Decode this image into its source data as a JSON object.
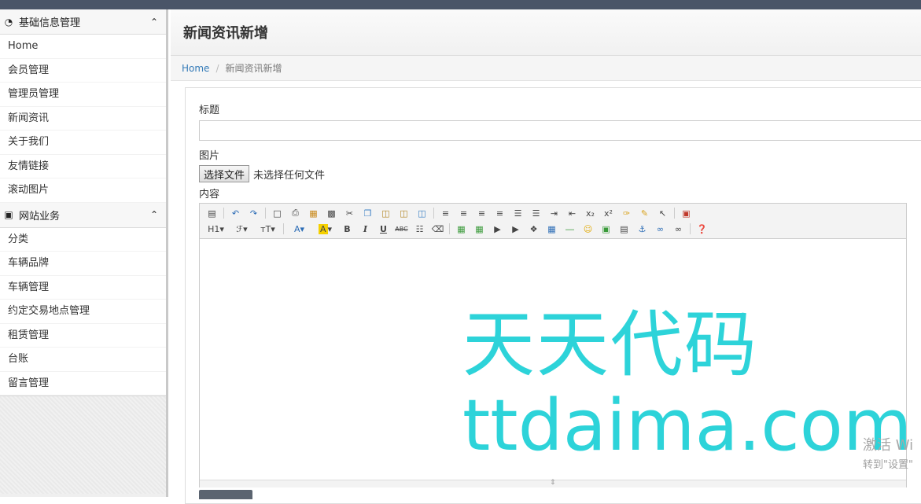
{
  "sidebar": {
    "sections": [
      {
        "title": "基础信息管理",
        "icon": "dashboard-icon",
        "items": [
          "Home",
          "会员管理",
          "管理员管理",
          "新闻资讯",
          "关于我们",
          "友情链接",
          "滚动图片"
        ]
      },
      {
        "title": "网站业务",
        "icon": "briefcase-icon",
        "items": [
          "分类",
          "车辆品牌",
          "车辆管理",
          "约定交易地点管理",
          "租赁管理",
          "台账",
          "留言管理"
        ]
      }
    ]
  },
  "page": {
    "title": "新闻资讯新增",
    "breadcrumb": {
      "home": "Home",
      "current": "新闻资讯新增"
    }
  },
  "form": {
    "title_label": "标题",
    "title_value": "",
    "image_label": "图片",
    "file_button": "选择文件",
    "file_status": "未选择任何文件",
    "content_label": "内容"
  },
  "editor": {
    "toolbar_row2_text": {
      "heading": "H1",
      "font_family": "ℱ",
      "font_size": "тT"
    }
  },
  "watermark": {
    "cn": "天天代码",
    "en": "ttdaima.com"
  },
  "os_overlay": {
    "line1": "激活 Wi",
    "line2": "转到\"设置\""
  }
}
